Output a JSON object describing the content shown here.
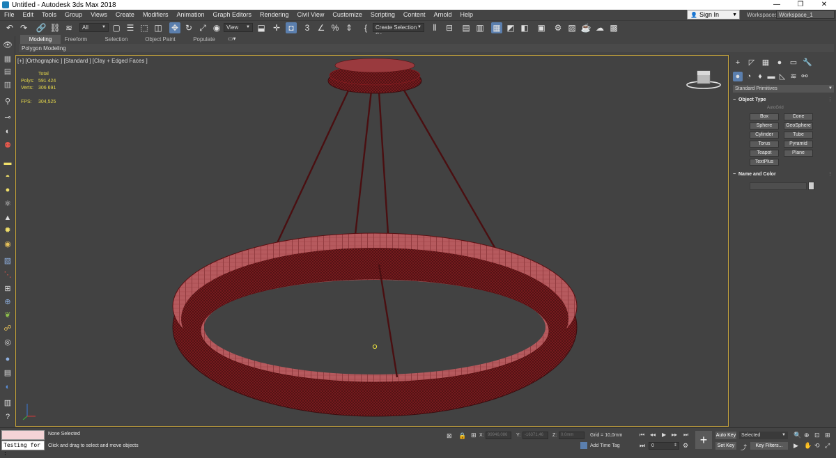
{
  "window": {
    "title": "Untitled - Autodesk 3ds Max 2018",
    "minimize": "—",
    "maximize": "❐",
    "close": "✕"
  },
  "menu": [
    "File",
    "Edit",
    "Tools",
    "Group",
    "Views",
    "Create",
    "Modifiers",
    "Animation",
    "Graph Editors",
    "Rendering",
    "Civil View",
    "Customize",
    "Scripting",
    "Content",
    "Arnold",
    "Help"
  ],
  "account": {
    "signin": "Sign In",
    "workspaces_label": "Workspaces:",
    "workspace": "Workspace_1"
  },
  "toolbar": {
    "filter": "All",
    "refcoord": "View",
    "named_selection": "Create Selection Se"
  },
  "ribbon": {
    "tabs": [
      "Modeling",
      "Freeform",
      "Selection",
      "Object Paint",
      "Populate"
    ],
    "active_tab": "Modeling",
    "panel": "Polygon Modeling"
  },
  "viewport": {
    "label": "[+] [Orthographic ] [Standard ] [Clay + Edged Faces ]",
    "stats": {
      "total_label": "Total",
      "polys_label": "Polys:",
      "polys": "591 424",
      "verts_label": "Verts:",
      "verts": "306 691",
      "fps_label": "FPS:",
      "fps": "304,525"
    },
    "wire_color": "#7a1418",
    "accent_color": "#c8a53a"
  },
  "command_panel": {
    "category": "Standard Primitives",
    "object_type": "Object Type",
    "autogrid": "AutoGrid",
    "buttons": [
      "Box",
      "Cone",
      "Sphere",
      "GeoSphere",
      "Cylinder",
      "Tube",
      "Torus",
      "Pyramid",
      "Teapot",
      "Plane",
      "TextPlus"
    ],
    "name_and_color": "Name and Color",
    "collapse_sign": "−"
  },
  "status": {
    "maxscript": "Testing for :",
    "selection": "None Selected",
    "prompt": "Click and drag to select and move objects",
    "x_label": "X:",
    "x": "99946,086",
    "y_label": "Y:",
    "y": "-16371,46",
    "z_label": "Z:",
    "z": "0,0mm",
    "grid": "Grid = 10,0mm",
    "add_time_tag": "Add Time Tag",
    "frame": "0",
    "auto_key": "Auto Key",
    "set_key": "Set Key",
    "key_mode": "Selected",
    "key_filters": "Key Filters..."
  }
}
